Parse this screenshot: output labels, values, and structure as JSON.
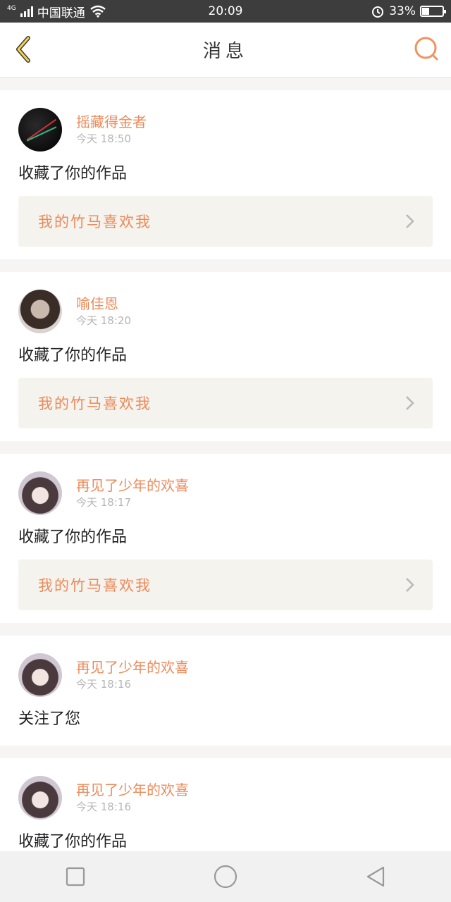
{
  "status_bar": {
    "network": "4G",
    "carrier": "中国联通",
    "time": "20:09",
    "battery": "33%",
    "battery_level": 0.33
  },
  "header": {
    "title": "消息",
    "back_icon": "chevron-left-icon",
    "search_icon": "search-icon"
  },
  "notifications": [
    {
      "username": "摇藏得金者",
      "time": "今天 18:50",
      "action": "收藏了你的作品",
      "work": "我的竹马喜欢我"
    },
    {
      "username": "喻佳恩",
      "time": "今天 18:20",
      "action": "收藏了你的作品",
      "work": "我的竹马喜欢我"
    },
    {
      "username": "再见了少年的欢喜",
      "time": "今天 18:17",
      "action": "收藏了你的作品",
      "work": "我的竹马喜欢我"
    },
    {
      "username": "再见了少年的欢喜",
      "time": "今天 18:16",
      "action": "关注了您"
    },
    {
      "username": "再见了少年的欢喜",
      "time": "今天 18:16",
      "action": "收藏了你的作品"
    }
  ],
  "colors": {
    "accent": "#ee8a5a",
    "card_bg": "#ffffff",
    "link_bg": "#f4f3ee"
  },
  "nav": {
    "icons": [
      "square-icon",
      "circle-icon",
      "triangle-back-icon"
    ]
  }
}
